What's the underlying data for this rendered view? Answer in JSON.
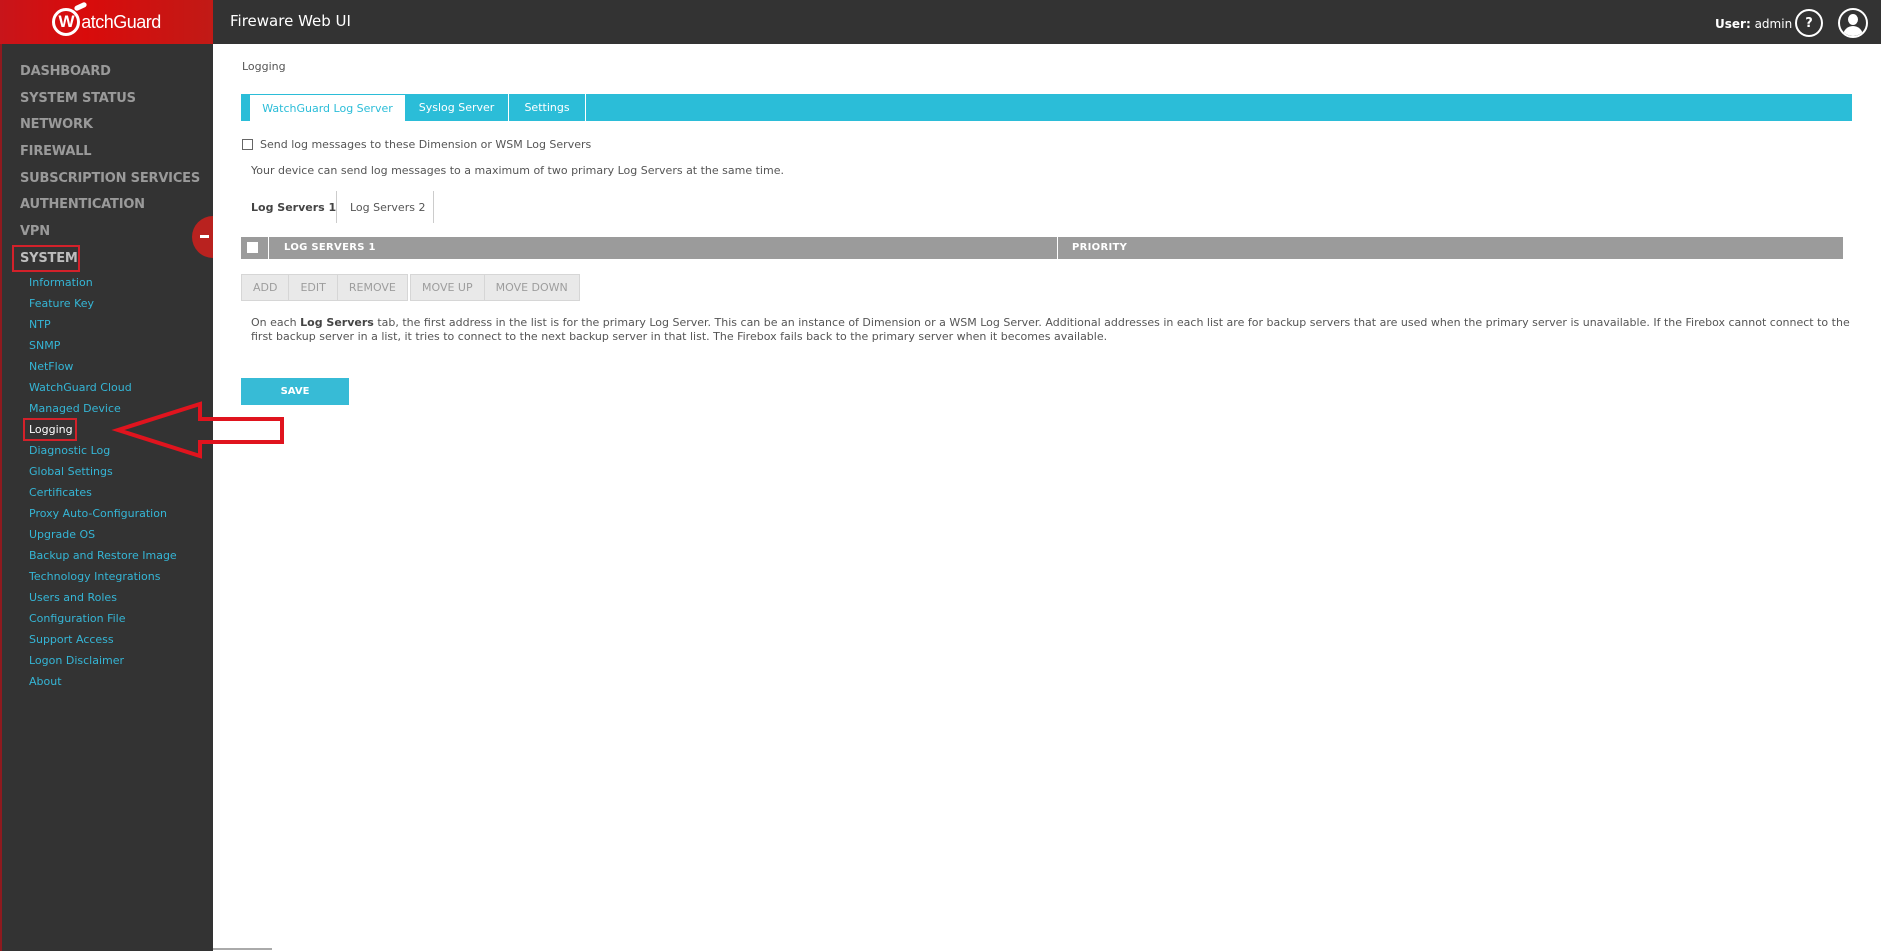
{
  "header": {
    "logo_text": "atchGuard",
    "logo_letter": "W",
    "app_title": "Fireware Web UI",
    "user_prefix": "User:",
    "user_name": "admin",
    "help_icon": "?"
  },
  "sidebar": {
    "top_items": [
      {
        "label": "DASHBOARD"
      },
      {
        "label": "SYSTEM STATUS"
      },
      {
        "label": "NETWORK"
      },
      {
        "label": "FIREWALL"
      },
      {
        "label": "SUBSCRIPTION SERVICES"
      },
      {
        "label": "AUTHENTICATION"
      },
      {
        "label": "VPN"
      },
      {
        "label": "SYSTEM"
      }
    ],
    "system_items": [
      {
        "label": "Information"
      },
      {
        "label": "Feature Key"
      },
      {
        "label": "NTP"
      },
      {
        "label": "SNMP"
      },
      {
        "label": "NetFlow"
      },
      {
        "label": "WatchGuard Cloud"
      },
      {
        "label": "Managed Device"
      },
      {
        "label": "Logging"
      },
      {
        "label": "Diagnostic Log"
      },
      {
        "label": "Global Settings"
      },
      {
        "label": "Certificates"
      },
      {
        "label": "Proxy Auto-Configuration"
      },
      {
        "label": "Upgrade OS"
      },
      {
        "label": "Backup and Restore Image"
      },
      {
        "label": "Technology Integrations"
      },
      {
        "label": "Users and Roles"
      },
      {
        "label": "Configuration File"
      },
      {
        "label": "Support Access"
      },
      {
        "label": "Logon Disclaimer"
      },
      {
        "label": "About"
      }
    ],
    "active_section": "SYSTEM",
    "active_item": "Logging"
  },
  "main": {
    "breadcrumb": "Logging",
    "tabs": [
      {
        "label": "WatchGuard Log Server",
        "active": true
      },
      {
        "label": "Syslog Server",
        "active": false
      },
      {
        "label": "Settings",
        "active": false
      }
    ],
    "send_checkbox": {
      "label": "Send log messages to these Dimension or WSM Log Servers",
      "checked": false
    },
    "info_text": "Your device can send log messages to a maximum of two primary Log Servers at the same time.",
    "subtabs": [
      {
        "label": "Log Servers 1",
        "active": true
      },
      {
        "label": "Log Servers 2",
        "active": false
      }
    ],
    "table": {
      "columns": [
        "LOG SERVERS 1",
        "PRIORITY"
      ],
      "rows": []
    },
    "buttons_group1": [
      "ADD",
      "EDIT",
      "REMOVE"
    ],
    "buttons_group2": [
      "MOVE UP",
      "MOVE DOWN"
    ],
    "paragraph": {
      "prefix": "On each ",
      "bold": "Log Servers",
      "suffix": " tab, the first address in the list is for the primary Log Server. This can be an instance of Dimension or a WSM Log Server. Additional addresses in each list are for backup servers that are used when the primary server is unavailable. If the Firebox cannot connect to the first backup server in a list, it tries to connect to the next backup server in that list. The Firebox fails back to the primary server when it becomes available."
    },
    "save_label": "SAVE"
  },
  "colors": {
    "brand_red": "#d90b0b",
    "header_bg": "#333333",
    "accent_cyan": "#2bbdd8",
    "link_blue": "#35b6d6",
    "annotation_red": "#e0141e"
  }
}
